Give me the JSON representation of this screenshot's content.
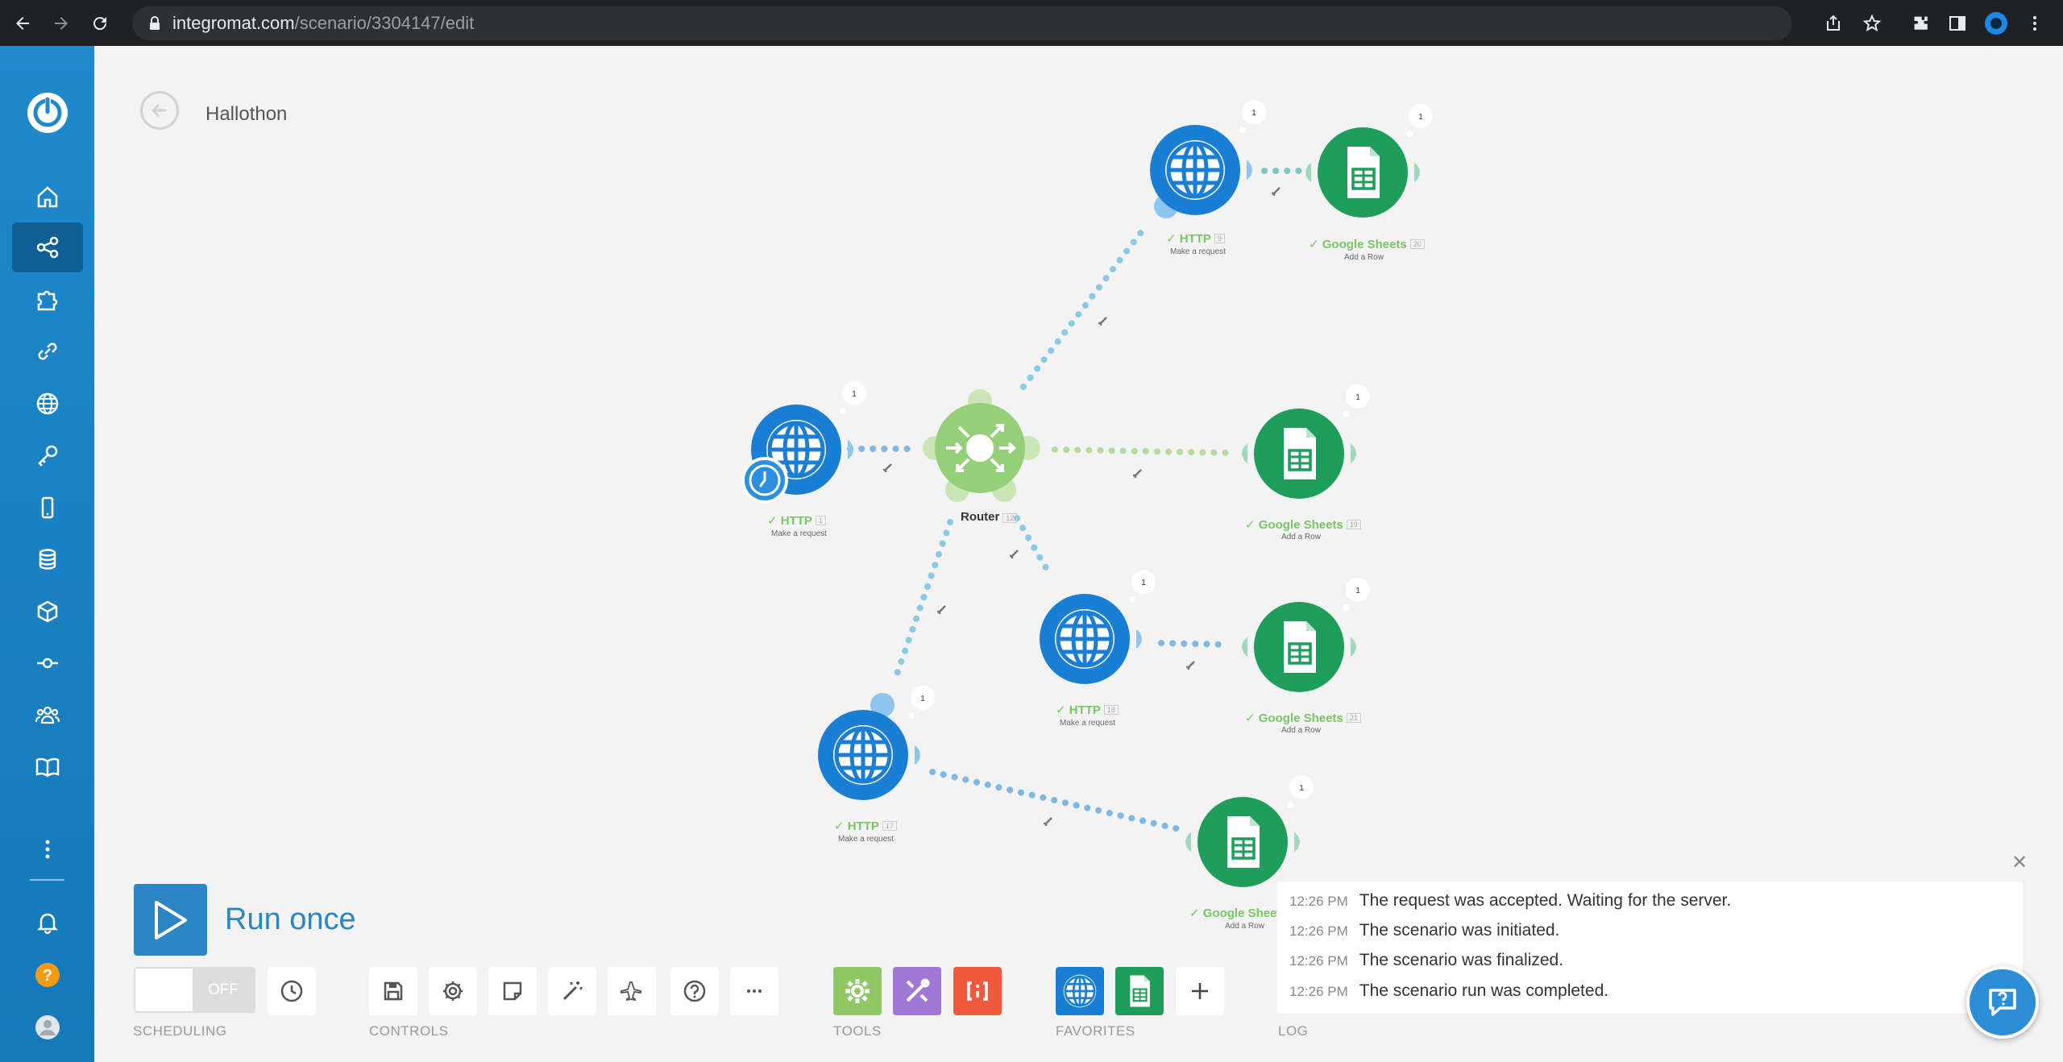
{
  "browser": {
    "url_host": "integromat.com",
    "url_path": "/scenario/3304147/edit"
  },
  "scenario": {
    "title": "Hallothon"
  },
  "modules": [
    {
      "id": "http-1",
      "name": "HTTP",
      "num": "1",
      "action": "Make a request",
      "badge": "1"
    },
    {
      "id": "router",
      "name": "Router",
      "num": "12"
    },
    {
      "id": "http-9",
      "name": "HTTP",
      "num": "9",
      "action": "Make a request",
      "badge": "1"
    },
    {
      "id": "sheets-20",
      "name": "Google Sheets",
      "num": "20",
      "action": "Add a Row",
      "badge": "1"
    },
    {
      "id": "sheets-19",
      "name": "Google Sheets",
      "num": "19",
      "action": "Add a Row",
      "badge": "1"
    },
    {
      "id": "http-18",
      "name": "HTTP",
      "num": "18",
      "action": "Make a request",
      "badge": "1"
    },
    {
      "id": "sheets-21",
      "name": "Google Sheets",
      "num": "21",
      "action": "Add a Row",
      "badge": "1"
    },
    {
      "id": "http-17",
      "name": "HTTP",
      "num": "17",
      "action": "Make a request",
      "badge": "1"
    },
    {
      "id": "sheets-22",
      "name": "Google Sheet",
      "action": "Add a Row",
      "badge": "1"
    }
  ],
  "toolbar": {
    "run_label": "Run once",
    "toggle_state": "OFF",
    "sections": {
      "scheduling": "SCHEDULING",
      "controls": "CONTROLS",
      "tools": "TOOLS",
      "favorites": "FAVORITES",
      "log": "LOG"
    }
  },
  "log": [
    {
      "time": "12:26 PM",
      "text": "The request was accepted. Waiting for the server."
    },
    {
      "time": "12:26 PM",
      "text": "The scenario was initiated."
    },
    {
      "time": "12:26 PM",
      "text": "The scenario was finalized."
    },
    {
      "time": "12:26 PM",
      "text": "The scenario run was completed."
    }
  ],
  "colors": {
    "sidebar": "#1f89cc",
    "http": "#1a7fd4",
    "sheets": "#1e9e5a",
    "router": "#95cf77",
    "accent": "#2a86c5",
    "label_green": "#7bc567"
  },
  "icons": {
    "sidebar": [
      "home-icon",
      "scenarios-icon",
      "templates-icon",
      "connections-icon",
      "webhooks-icon",
      "keys-icon",
      "devices-icon",
      "datastores-icon",
      "datastructures-icon",
      "flow-icon",
      "team-icon",
      "docs-icon",
      "more-icon",
      "bell-icon",
      "help-icon",
      "user-icon"
    ]
  }
}
